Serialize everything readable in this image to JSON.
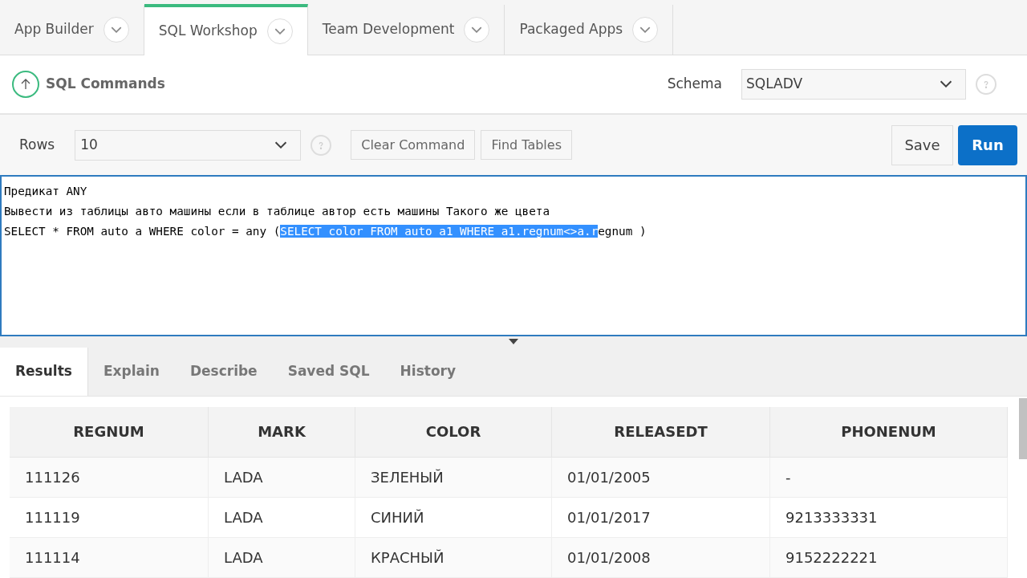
{
  "nav_tabs": [
    {
      "label": "App Builder",
      "selected": false
    },
    {
      "label": "SQL Workshop",
      "selected": true
    },
    {
      "label": "Team Development",
      "selected": false
    },
    {
      "label": "Packaged Apps",
      "selected": false
    }
  ],
  "header": {
    "title": "SQL Commands",
    "schema_label": "Schema",
    "schema_value": "SQLADV"
  },
  "toolbar": {
    "rows_label": "Rows",
    "rows_value": "10",
    "buttons": [
      "Clear Command",
      "Find Tables"
    ],
    "save": "Save",
    "run": "Run"
  },
  "editor": {
    "lines": [
      {
        "before": "Предикат ANY"
      },
      {
        "before": "Вывести из таблицы авто машины если в таблице автор есть машины Такого же цвета"
      },
      {
        "before": "SELECT * FROM auto a WHERE color = any (",
        "selected": "SELECT color FROM auto a1 WHERE a1.regnum<>a.r",
        "after": "egnum )"
      }
    ]
  },
  "result_tabs": [
    {
      "label": "Results",
      "selected": true
    },
    {
      "label": "Explain",
      "selected": false
    },
    {
      "label": "Describe",
      "selected": false
    },
    {
      "label": "Saved SQL",
      "selected": false
    },
    {
      "label": "History",
      "selected": false
    }
  ],
  "table": {
    "columns": [
      "REGNUM",
      "MARK",
      "COLOR",
      "RELEASEDT",
      "PHONENUM"
    ],
    "rows": [
      [
        "111126",
        "LADA",
        "ЗЕЛЕНЫЙ",
        "01/01/2005",
        "-"
      ],
      [
        "111119",
        "LADA",
        "СИНИЙ",
        "01/01/2017",
        "9213333331"
      ],
      [
        "111114",
        "LADA",
        "КРАСНЫЙ",
        "01/01/2008",
        "9152222221"
      ]
    ]
  }
}
